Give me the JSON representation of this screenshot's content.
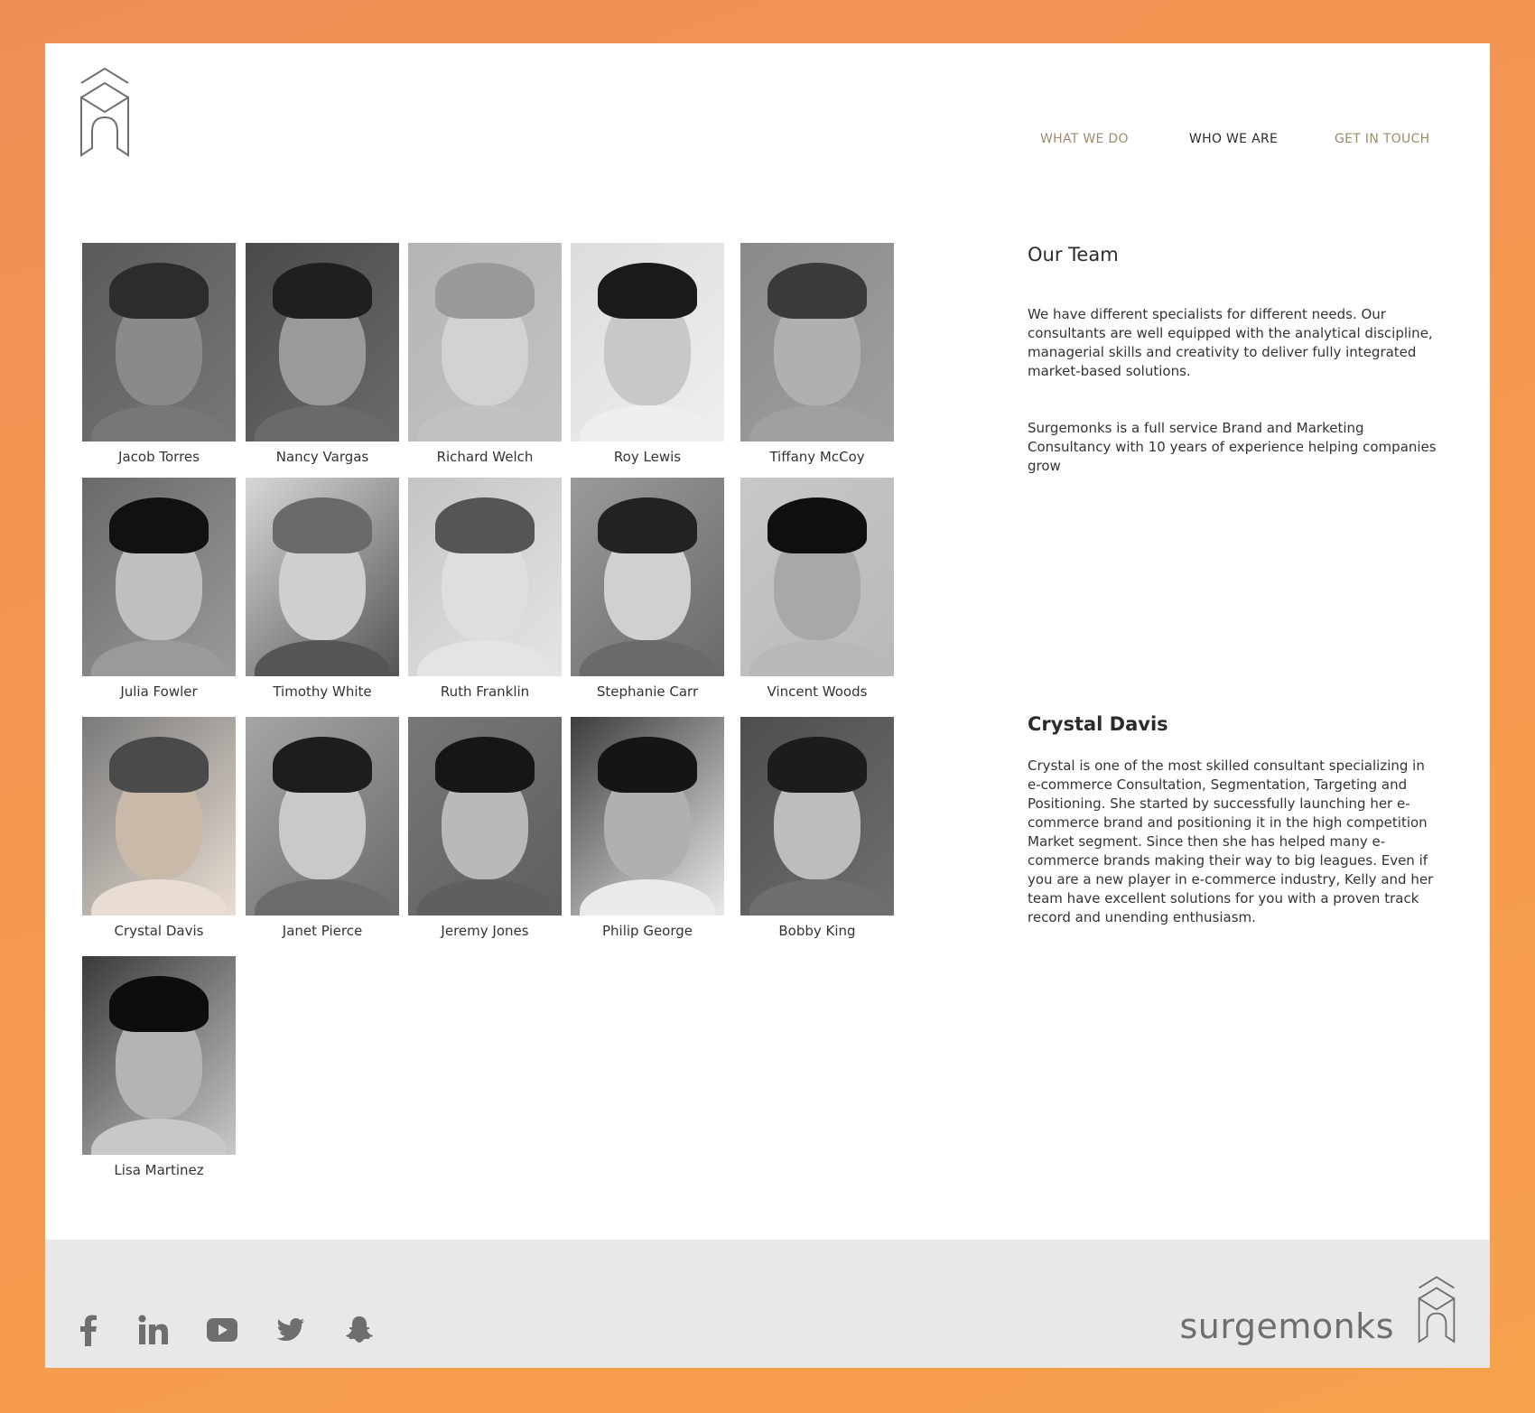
{
  "nav": {
    "items": [
      {
        "label": "WHAT WE DO",
        "active": false
      },
      {
        "label": "WHO WE ARE",
        "active": true
      },
      {
        "label": "GET IN TOUCH",
        "active": false
      }
    ]
  },
  "team": {
    "title": "Our Team",
    "paragraph1": "We have different specialists for different needs. Our consultants are well equipped with the analytical discipline, managerial skills and creativity to deliver fully integrated market-based solutions.",
    "paragraph2": "Surgemonks is a full service Brand and Marketing Consultancy with 10 years of experience helping companies grow",
    "members": [
      {
        "name": "Jacob Torres"
      },
      {
        "name": "Nancy Vargas"
      },
      {
        "name": "Richard Welch"
      },
      {
        "name": "Roy Lewis"
      },
      {
        "name": "Tiffany McCoy"
      },
      {
        "name": "Julia Fowler"
      },
      {
        "name": "Timothy White"
      },
      {
        "name": "Ruth Franklin"
      },
      {
        "name": "Stephanie Carr"
      },
      {
        "name": "Vincent Woods"
      },
      {
        "name": "Crystal Davis"
      },
      {
        "name": "Janet Pierce"
      },
      {
        "name": "Jeremy Jones"
      },
      {
        "name": "Philip George"
      },
      {
        "name": "Bobby King"
      },
      {
        "name": "Lisa Martinez"
      }
    ]
  },
  "selected_member": {
    "name": "Crystal Davis",
    "bio": "Crystal is one of the most skilled consultant specializing in e-commerce Consultation, Segmentation, Targeting and Positioning. She started by successfully launching her e-commerce brand and positioning it in the high competition Market segment. Since then she has helped many e-commerce brands making their way to big leagues. Even if you are a new player in e-commerce industry, Kelly and her team have excellent solutions for you with a proven track record and unending enthusiasm."
  },
  "footer": {
    "brand": "surgemonks",
    "social_icons": [
      "facebook-icon",
      "linkedin-icon",
      "youtube-icon",
      "twitter-icon",
      "snapchat-icon"
    ]
  },
  "colors": {
    "nav_inactive": "#a08a6c",
    "nav_active": "#2b2b2b",
    "footer_bg": "#e8e8e8",
    "icon_gray": "#6e6e6e",
    "frame_bg": "#ffffff"
  }
}
